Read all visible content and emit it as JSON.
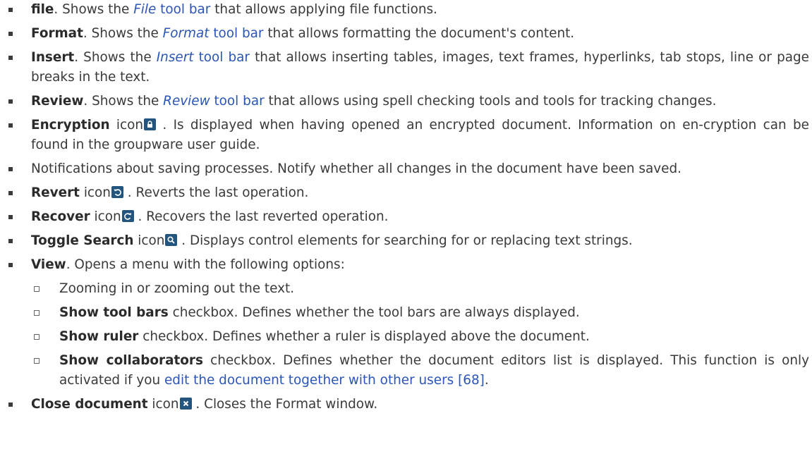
{
  "items": [
    {
      "bold": "file",
      "t1": ". Shows the ",
      "link_italic": "File",
      "link_rest": " tool bar",
      "t2": " that allows applying file functions."
    },
    {
      "bold": "Format",
      "t1": ". Shows the ",
      "link_italic": "Format",
      "link_rest": " tool bar",
      "t2": " that allows formatting the document's content."
    },
    {
      "bold": "Insert",
      "t1": ". Shows the ",
      "link_italic": "Insert",
      "link_rest": " tool bar",
      "t2": " that allows inserting tables, images, text frames, hyperlinks, tab stops, line or page breaks in the text."
    },
    {
      "bold": "Review",
      "t1": ". Shows the ",
      "link_italic": "Review",
      "link_rest": " tool bar",
      "t2": " that allows using spell checking tools and tools for tracking changes."
    },
    {
      "bold": "Encryption",
      "icon_word": " icon",
      "t": " . Is displayed when having opened an encrypted document. Information on en-cryption can be found in the groupware user guide."
    },
    {
      "text": "Notifications about saving processes. Notify whether all changes in the document have been saved."
    },
    {
      "bold": "Revert",
      "icon_word": " icon",
      "t": " . Reverts the last operation."
    },
    {
      "bold": "Recover",
      "icon_word": " icon",
      "t": " . Recovers the last reverted operation."
    },
    {
      "bold": "Toggle Search",
      "icon_word": " icon",
      "t": " . Displays control elements for searching for or replacing text strings."
    },
    {
      "bold": "View",
      "t": ". Opens a menu with the following options:"
    },
    {
      "bold": "Close document",
      "icon_word": " icon",
      "t": " . Closes the Format window."
    }
  ],
  "view_options": [
    {
      "text": "Zooming in or zooming out the text."
    },
    {
      "bold": "Show tool bars",
      "t": " checkbox. Defines whether the tool bars are always displayed."
    },
    {
      "bold": "Show ruler",
      "t": " checkbox. Defines whether a ruler is displayed above the document."
    },
    {
      "bold": "Show collaborators",
      "t": " checkbox. Defines whether the document editors list is displayed. This function is only activated if you ",
      "link": "edit the document together with other users [68]",
      "t_end": "."
    }
  ],
  "icons": {
    "encryption": "lock-icon",
    "revert": "undo-icon",
    "recover": "redo-icon",
    "toggle_search": "search-icon",
    "close_document": "close-icon"
  },
  "colors": {
    "text": "#3a3a3a",
    "link": "#2b55b6",
    "icon_bg": "#23557e"
  }
}
